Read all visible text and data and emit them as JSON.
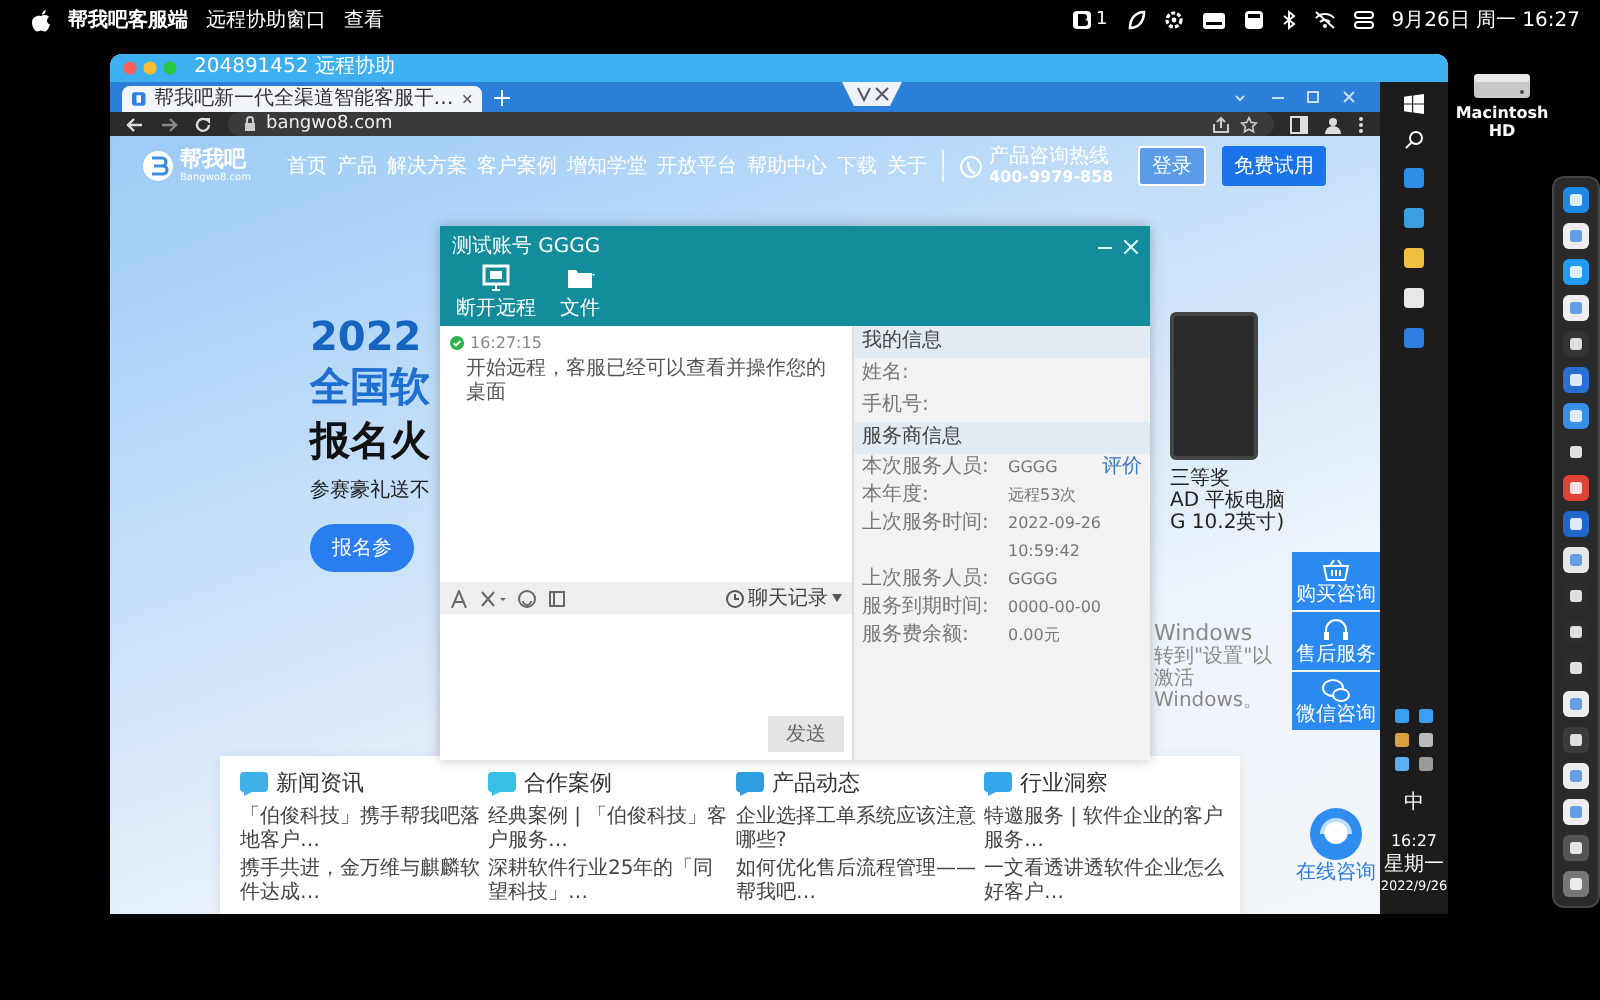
{
  "menubar": {
    "app": "帮我吧客服端",
    "items": [
      "远程协助窗口",
      "查看"
    ],
    "badge": "1",
    "clock": "9月26日 周一 16:27"
  },
  "desktop_icon": {
    "label": "Macintosh HD"
  },
  "remote_window": {
    "title": "204891452 远程协助"
  },
  "browser": {
    "tabs": [
      {
        "title": "帮我吧新一代全渠道智能客服干…",
        "selected": true
      }
    ],
    "url": "bangwo8.com"
  },
  "site": {
    "logo": "帮我吧",
    "logo_sub": "Bangwo8.com",
    "nav": [
      "首页",
      "产品",
      "解决方案",
      "客户案例",
      "增知学堂",
      "开放平台",
      "帮助中心",
      "下载",
      "关于"
    ],
    "hotline_label": "产品咨询热线",
    "hotline": "400-9979-858",
    "login": "登录",
    "trial": "免费试用",
    "hero": {
      "year": "2022",
      "line1": "全国软",
      "line2": "报名火",
      "sub": "参赛豪礼送不",
      "cta": "报名参"
    },
    "prize": {
      "rank": "三等奖",
      "name": "AD 平板电脑",
      "spec": "G 10.2英寸)"
    },
    "sections": [
      {
        "title": "新闻资讯",
        "items": [
          "「伯俊科技」携手帮我吧落地客户…",
          "携手共进，金万维与麒麟软件达成…"
        ]
      },
      {
        "title": "合作案例",
        "items": [
          "经典案例 | 「伯俊科技」客户服务…",
          "深耕软件行业25年的「同望科技」…"
        ]
      },
      {
        "title": "产品动态",
        "items": [
          "企业选择工单系统应该注意哪些?",
          "如何优化售后流程管理——帮我吧…"
        ]
      },
      {
        "title": "行业洞察",
        "items": [
          "特邀服务 | 软件企业的客户服务…",
          "一文看透讲透软件企业怎么好客户…"
        ]
      }
    ],
    "float_menu": [
      {
        "kind": "cart",
        "label": "购买咨询"
      },
      {
        "kind": "headset",
        "label": "售后服务"
      },
      {
        "kind": "wechat",
        "label": "微信咨询"
      }
    ],
    "online": "在线咨询"
  },
  "activation": {
    "title": "Windows",
    "hint": "转到\"设置\"以激活 Windows。"
  },
  "taskbar": {
    "ime": "中",
    "time": "16:27",
    "weekday": "星期一",
    "date": "2022/9/26"
  },
  "dialog": {
    "title": "测试账号 GGGG",
    "tools": [
      {
        "kind": "screen",
        "label": "断开远程"
      },
      {
        "kind": "folder",
        "label": "文件"
      }
    ],
    "messages": [
      {
        "time": "16:27:15",
        "text": "开始远程，客服已经可以查看并操作您的桌面"
      }
    ],
    "history": "聊天记录",
    "send": "发送",
    "my_info": {
      "title": "我的信息",
      "labels": [
        "姓名:",
        "手机号:"
      ]
    },
    "provider": {
      "title": "服务商信息",
      "rows": [
        {
          "label": "本次服务人员:",
          "value": "GGGG",
          "link": "评价"
        },
        {
          "label": "本年度:",
          "value": "远程53次"
        },
        {
          "label": "上次服务时间:",
          "value": "2022-09-26"
        },
        {
          "value": "10:59:42"
        },
        {
          "label": "上次服务人员:",
          "value": "GGGG"
        },
        {
          "label": "服务到期时间:",
          "value": "0000-00-00"
        },
        {
          "label": "服务费余额:",
          "value": "0.00元"
        }
      ]
    }
  }
}
